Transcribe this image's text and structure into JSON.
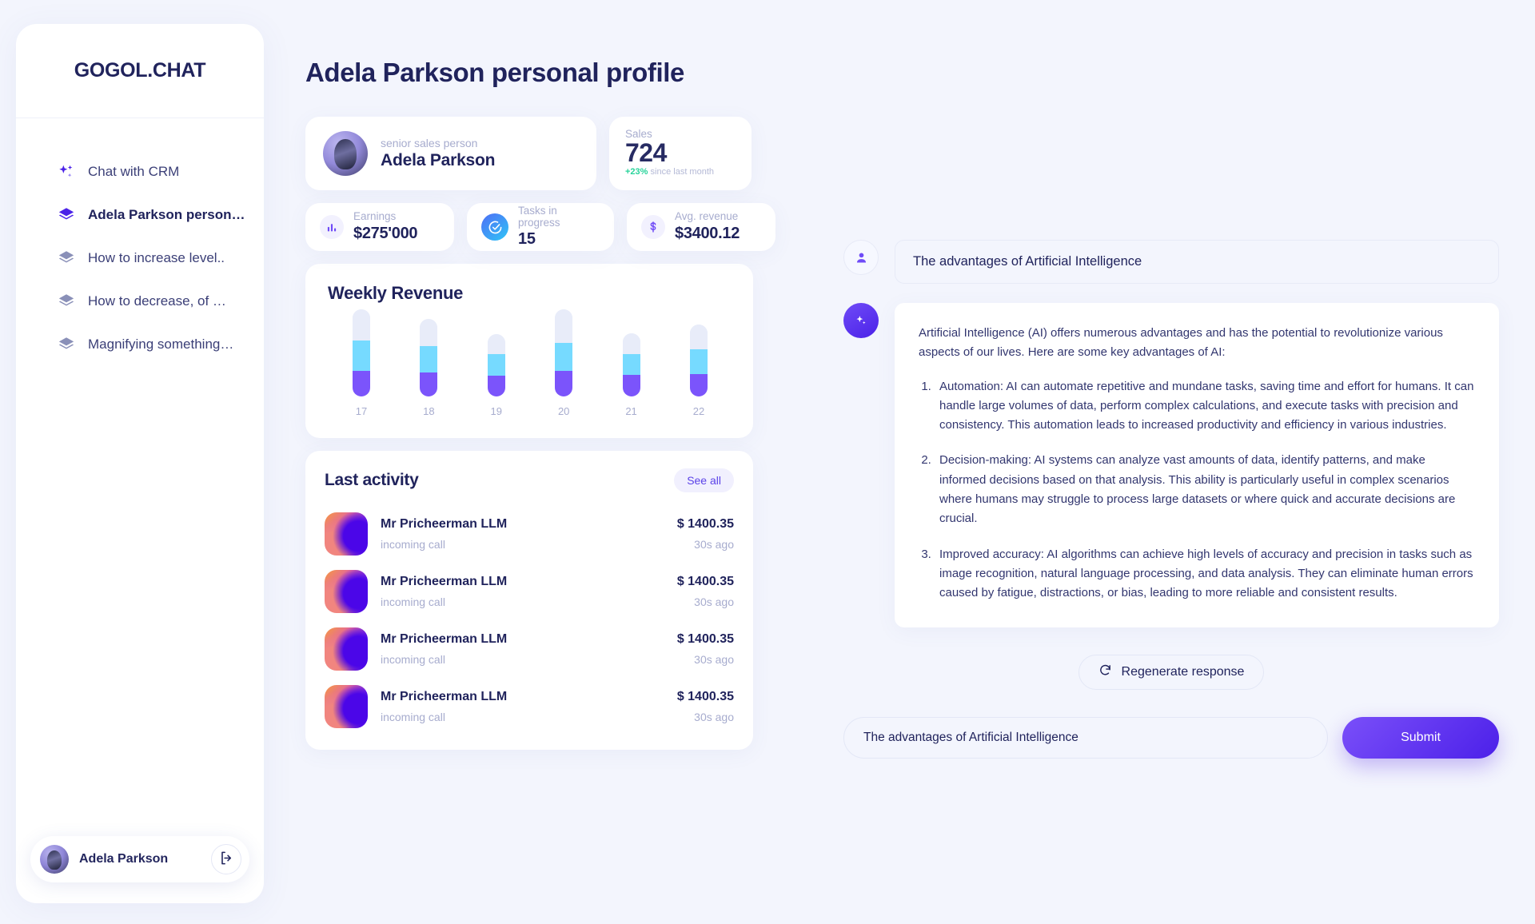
{
  "brand": {
    "name": "GOGOL.CHAT"
  },
  "sidebar": {
    "items": [
      {
        "label": "Chat with CRM",
        "icon": "sparkle-icon",
        "active": false
      },
      {
        "label": "Adela Parkson personal…",
        "icon": "layers-icon",
        "active": true
      },
      {
        "label": "How to increase level..",
        "icon": "layers-icon",
        "active": false
      },
      {
        "label": "How to decrease, of …",
        "icon": "layers-icon",
        "active": false
      },
      {
        "label": "Magnifying something…",
        "icon": "layers-icon",
        "active": false
      }
    ],
    "footer": {
      "user_name": "Adela Parkson",
      "logout_icon": "logout-icon"
    }
  },
  "main": {
    "page_title": "Adela Parkson personal profile",
    "profile": {
      "role": "senior sales person",
      "name": "Adela Parkson"
    },
    "sales": {
      "label": "Sales",
      "value": "724",
      "change": "+23%",
      "change_note": "since last month"
    },
    "stats": [
      {
        "label": "Earnings",
        "value": "$275'000",
        "icon": "bar-chart-icon"
      },
      {
        "label": "Tasks in progress",
        "value": "15",
        "icon": "check-circle-icon"
      },
      {
        "label": "Avg. revenue",
        "value": "$3400.12",
        "icon": "dollar-icon"
      }
    ],
    "activity": {
      "title": "Last activity",
      "see_all_label": "See all",
      "rows": [
        {
          "name": "Mr Pricheerman LLM",
          "type": "incoming call",
          "amount": "$ 1400.35",
          "time": "30s ago"
        },
        {
          "name": "Mr Pricheerman LLM",
          "type": "incoming call",
          "amount": "$ 1400.35",
          "time": "30s ago"
        },
        {
          "name": "Mr Pricheerman LLM",
          "type": "incoming call",
          "amount": "$ 1400.35",
          "time": "30s ago"
        },
        {
          "name": "Mr Pricheerman LLM",
          "type": "incoming call",
          "amount": "$ 1400.35",
          "time": "30s ago"
        }
      ]
    }
  },
  "chart_data": {
    "type": "bar",
    "title": "Weekly Revenue",
    "xlabel": "",
    "ylabel": "",
    "stacked": true,
    "grid": false,
    "legend": false,
    "categories": [
      "17",
      "18",
      "19",
      "20",
      "21",
      "22"
    ],
    "series": [
      {
        "name": "segment-1",
        "color": "#7b54fb",
        "values": [
          32,
          30,
          26,
          32,
          27,
          28
        ]
      },
      {
        "name": "segment-2",
        "color": "#76daff",
        "values": [
          38,
          33,
          27,
          35,
          26,
          31
        ]
      },
      {
        "name": "segment-3",
        "color": "#e8ecf9",
        "values": [
          39,
          34,
          25,
          42,
          26,
          31
        ]
      }
    ],
    "totals": [
      109,
      97,
      78,
      109,
      79,
      90
    ],
    "ylim": [
      0,
      120
    ]
  },
  "chat": {
    "user_message": "The advantages of Artificial Intelligence",
    "ai_intro": "Artificial Intelligence (AI) offers numerous advantages and has the potential to revolutionize various aspects of our lives. Here are some key advantages of AI:",
    "ai_points": [
      "Automation: AI can automate repetitive and mundane tasks, saving time and effort for humans. It can handle large volumes of data, perform complex calculations, and execute tasks with precision and consistency. This automation leads to increased productivity and efficiency in various industries.",
      "Decision-making: AI systems can analyze vast amounts of data, identify patterns, and make informed decisions based on that analysis. This ability is particularly useful in complex scenarios where humans may struggle to process large datasets or where quick and accurate decisions are crucial.",
      "Improved accuracy: AI algorithms can achieve high levels of accuracy and precision in tasks such as image recognition, natural language processing, and data analysis. They can eliminate human errors caused by fatigue, distractions, or bias, leading to more reliable and consistent results."
    ],
    "regenerate_label": "Regenerate response",
    "input_value": "The advantages of Artificial Intelligence",
    "submit_label": "Submit"
  },
  "colors": {
    "accent": "#5b42e8",
    "bg": "#f3f5fd",
    "text_dark": "#20235c",
    "text_muted": "#a7acce",
    "positive": "#27d39a",
    "bar_purple": "#7b54fb",
    "bar_cyan": "#76daff",
    "bar_light": "#e8ecf9"
  }
}
